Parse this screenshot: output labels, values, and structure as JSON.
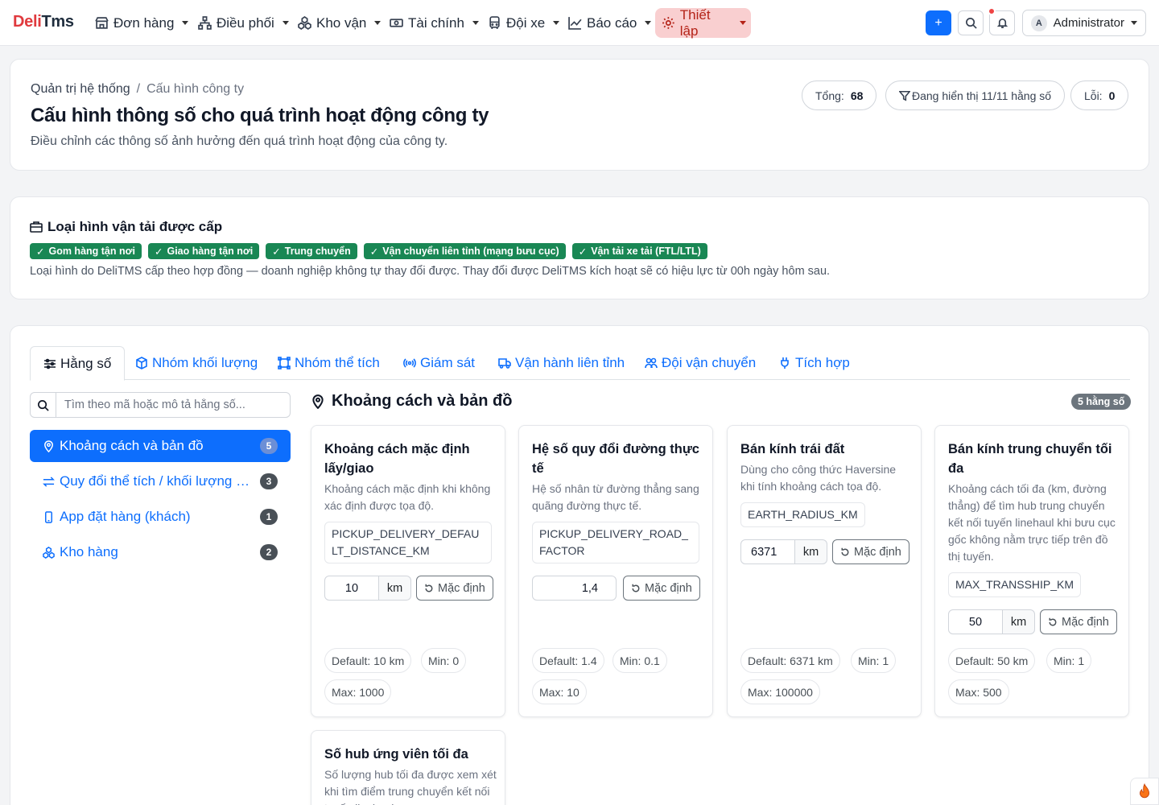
{
  "brand": {
    "part1": "Deli",
    "part2": "Tms"
  },
  "nav": [
    {
      "label": "Đơn hàng",
      "icon": "shop-icon"
    },
    {
      "label": "Điều phối",
      "icon": "diagram-icon"
    },
    {
      "label": "Kho vận",
      "icon": "boxes-icon"
    },
    {
      "label": "Tài chính",
      "icon": "cash-icon"
    },
    {
      "label": "Đội xe",
      "icon": "bus-icon"
    },
    {
      "label": "Báo cáo",
      "icon": "graph-icon"
    },
    {
      "label": "Thiết lập",
      "icon": "gear-icon",
      "active": true
    }
  ],
  "user": {
    "initial": "A",
    "name": "Administrator"
  },
  "header": {
    "breadcrumb_root": "Quản trị hệ thống",
    "breadcrumb_sep": "/",
    "breadcrumb_current": "Cấu hình công ty",
    "title": "Cấu hình thông số cho quá trình hoạt động công ty",
    "subtitle": "Điều chỉnh các thông số ảnh hưởng đến quá trình hoạt động của công ty.",
    "total_label": "Tổng:",
    "total_value": "68",
    "filter_label": "Đang hiển thị 11/11 hằng số",
    "error_label": "Lỗi:",
    "error_value": "0"
  },
  "transport": {
    "title": "Loại hình vận tải được cấp",
    "tags": [
      "Gom hàng tận nơi",
      "Giao hàng tận nơi",
      "Trung chuyển",
      "Vận chuyển liên tỉnh (mạng bưu cục)",
      "Vận tải xe tải (FTL/LTL)"
    ],
    "note": "Loại hình do DeliTMS cấp theo hợp đồng — doanh nghiệp không tự thay đổi được. Thay đổi được DeliTMS kích hoạt sẽ có hiệu lực từ 00h ngày hôm sau."
  },
  "tabs": [
    {
      "label": "Hằng số",
      "active": true
    },
    {
      "label": "Nhóm khối lượng"
    },
    {
      "label": "Nhóm thể tích"
    },
    {
      "label": "Giám sát"
    },
    {
      "label": "Vận hành liên tỉnh"
    },
    {
      "label": "Đội vận chuyển"
    },
    {
      "label": "Tích hợp"
    }
  ],
  "search": {
    "placeholder": "Tìm theo mã hoặc mô tả hằng số..."
  },
  "sidebar": [
    {
      "label": "Khoảng cách và bản đồ",
      "count": "5",
      "active": true
    },
    {
      "label": "Quy đổi thể tích / khối lượng hàng",
      "count": "3"
    },
    {
      "label": "App đặt hàng (khách)",
      "count": "1"
    },
    {
      "label": "Kho hàng",
      "count": "2"
    }
  ],
  "section": {
    "title": "Khoảng cách và bản đồ",
    "badge": "5 hằng số"
  },
  "reset_label": "Mặc định",
  "params": [
    {
      "title": "Khoảng cách mặc định lấy/giao",
      "desc": "Khoảng cách mặc định khi không xác định được tọa độ.",
      "code": "PICKUP_DELIVERY_DEFAULT_DISTANCE_KM",
      "value": "10",
      "unit": "km",
      "default": "Default: 10 km",
      "min": "Min: 0",
      "max": "Max: 1000"
    },
    {
      "title": "Hệ số quy đổi đường thực tế",
      "desc": "Hệ số nhân từ đường thẳng sang quãng đường thực tế.",
      "code": "PICKUP_DELIVERY_ROAD_FACTOR",
      "value": "1,4",
      "unit": "",
      "default": "Default: 1.4",
      "min": "Min: 0.1",
      "max": "Max: 10"
    },
    {
      "title": "Bán kính trái đất",
      "desc": "Dùng cho công thức Haversine khi tính khoảng cách tọa độ.",
      "code": "EARTH_RADIUS_KM",
      "value": "6371",
      "unit": "km",
      "default": "Default: 6371 km",
      "min": "Min: 1",
      "max": "Max: 100000"
    },
    {
      "title": "Bán kính trung chuyển tối đa",
      "desc": "Khoảng cách tối đa (km, đường thẳng) để tìm hub trung chuyển kết nối tuyến linehaul khi bưu cục gốc không nằm trực tiếp trên đồ thị tuyến.",
      "code": "MAX_TRANSSHIP_KM",
      "value": "50",
      "unit": "km",
      "default": "Default: 50 km",
      "min": "Min: 1",
      "max": "Max: 500"
    },
    {
      "title": "Số hub ứng viên tối đa",
      "desc": "Số lượng hub tối đa được xem xét khi tìm điểm trung chuyển kết nối tuyến linehaul."
    }
  ]
}
